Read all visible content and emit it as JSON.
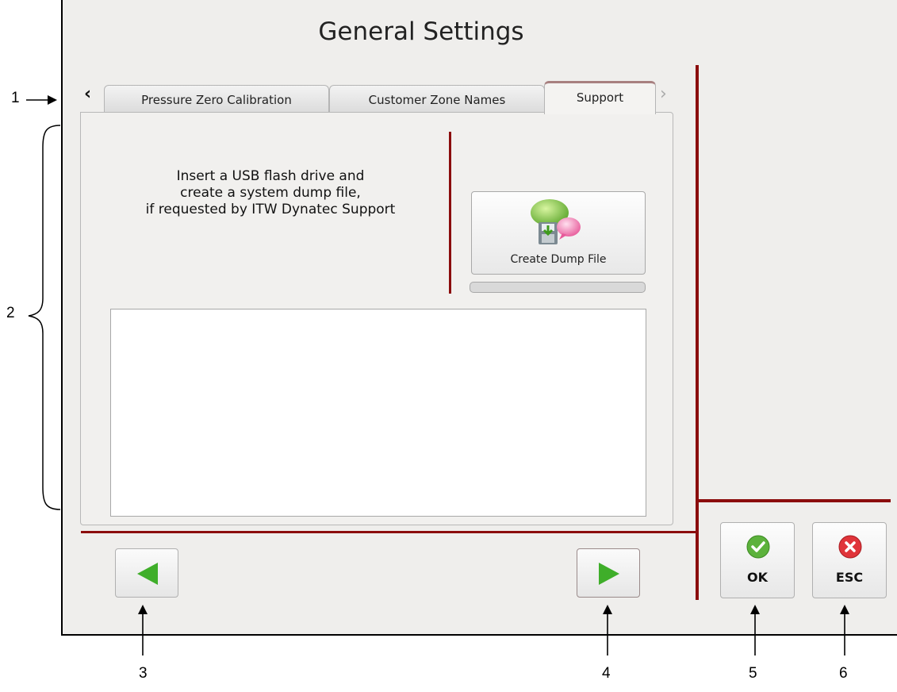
{
  "window": {
    "title": "General Settings"
  },
  "tabs": {
    "scroll_left_icon": "chevron-left-icon",
    "scroll_right_icon": "chevron-right-icon",
    "items": [
      {
        "label": "Pressure Zero Calibration",
        "active": false
      },
      {
        "label": "Customer Zone Names",
        "active": false
      },
      {
        "label": "Support",
        "active": true
      }
    ]
  },
  "support": {
    "instructions": "Insert a USB flash drive and\ncreate a system dump file,\nif requested by ITW Dynatec Support",
    "dump_button_label": "Create Dump File",
    "dump_button_icon": "speech-bubbles-floppy-icon",
    "progress": 0,
    "log_text": ""
  },
  "navigation": {
    "prev_icon": "green-arrow-left-icon",
    "next_icon": "green-arrow-right-icon"
  },
  "actions": {
    "ok_label": "OK",
    "esc_label": "ESC",
    "ok_icon": "green-check-circle-icon",
    "esc_icon": "red-x-circle-icon"
  },
  "callouts": {
    "c1": "1",
    "c2": "2",
    "c3": "3",
    "c4": "4",
    "c5": "5",
    "c6": "6"
  },
  "colors": {
    "divider": "#8b0d0d",
    "background": "#efeeec",
    "arrow_green": "#3fae2a",
    "ok_green": "#5cb23c",
    "esc_red": "#e0343a"
  }
}
